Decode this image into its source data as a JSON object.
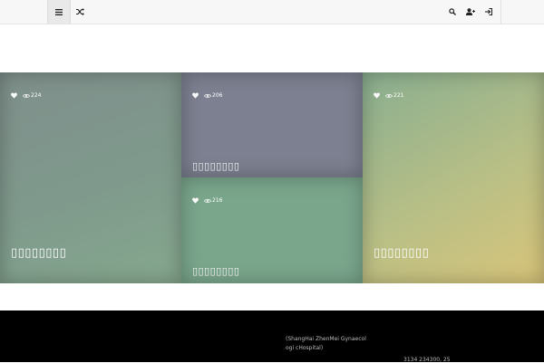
{
  "topbar": {
    "icons": [
      "menu-icon",
      "shuffle-icon",
      "search-icon",
      "user-add-icon",
      "login-icon"
    ]
  },
  "tiles": [
    {
      "views": "224",
      "title": "▯▯▯▯▯▯▯▯"
    },
    {
      "views": "206",
      "title": "▯▯▯▯▯▯▯▯"
    },
    {
      "views": "216",
      "title": "▯▯▯▯▯▯▯▯"
    },
    {
      "views": "221",
      "title": "▯▯▯▯▯▯▯▯"
    }
  ],
  "footer": {
    "name": "(ShangHai ZhenMei Gynaecologi cHospital)",
    "phone": "3134 234300, 25"
  },
  "colors": {
    "topbar_bg": "#f7f7f7",
    "footer_bg": "#000000",
    "text_light": "#ffffff"
  }
}
